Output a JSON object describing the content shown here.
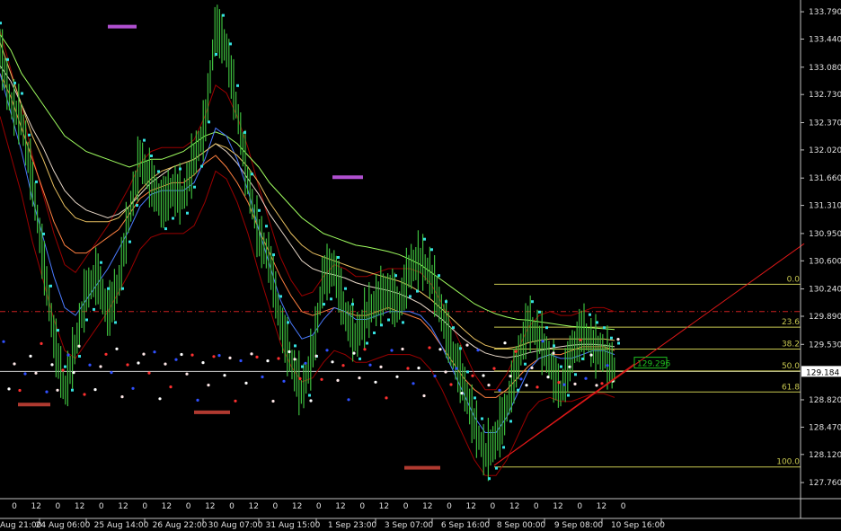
{
  "colors": {
    "background": "#000000",
    "axis": "#c0c0c0",
    "price_up": "#3dbb3d",
    "current_price_bg": "#ffffff",
    "current_price_fg": "#000000",
    "cyan_dots": "#35e0e0",
    "fib_line": "#c8c850",
    "red_dashdot": "#cc2020",
    "trendline": "#e01818",
    "envelope": "#9b0000",
    "ma_green": "#a0ff60",
    "ma_white": "#e8d8c8",
    "ma_orange": "#ff8040",
    "ma_blue": "#4a7bff",
    "ma_tan": "#e8c060",
    "purple_bar": "#b050d0",
    "brown_bar": "#b03a30",
    "box_label": "#20c020"
  },
  "chart_data": {
    "type": "line",
    "ylim": [
      127.6,
      133.86
    ],
    "y_ticks": [
      "133.790",
      "133.440",
      "133.080",
      "132.730",
      "132.370",
      "132.020",
      "131.660",
      "131.310",
      "130.950",
      "130.600",
      "130.240",
      "129.890",
      "129.530",
      "129.184",
      "128.820",
      "128.470",
      "128.120",
      "127.760"
    ],
    "y_tick_values": [
      133.79,
      133.44,
      133.08,
      132.73,
      132.37,
      132.02,
      131.66,
      131.31,
      130.95,
      130.6,
      130.24,
      129.89,
      129.53,
      129.184,
      128.82,
      128.47,
      128.12,
      127.76
    ],
    "current_price": "129.184",
    "current_price_value": 129.184,
    "box_label": "129.296",
    "box_label_value": 129.296,
    "date_labels": [
      "Aug 21:00",
      "24 Aug 06:00",
      "25 Aug 14:00",
      "26 Aug 22:00",
      "30 Aug 07:00",
      "31 Aug 15:00",
      "1 Sep 23:00",
      "3 Sep 07:00",
      "6 Sep 16:00",
      "8 Sep 00:00",
      "9 Sep 08:00",
      "10 Sep 16:00"
    ],
    "hour_labels": [
      "0",
      "12",
      "0",
      "12",
      "0",
      "12",
      "0",
      "12",
      "0",
      "12",
      "0",
      "12",
      "0",
      "12",
      "0",
      "12",
      "0",
      "12",
      "0",
      "12",
      "0",
      "12",
      "0",
      "12",
      "0",
      "12",
      "0",
      "12",
      "0"
    ],
    "fib_levels": [
      {
        "label": "0.0",
        "price": 130.3
      },
      {
        "label": "23.6",
        "price": 129.75
      },
      {
        "label": "38.2",
        "price": 129.47
      },
      {
        "label": "50.0",
        "price": 129.19
      },
      {
        "label": "61.8",
        "price": 128.92
      },
      {
        "label": "100.0",
        "price": 127.96
      }
    ],
    "red_dashdot_price": 129.95,
    "bar_indices": [
      0,
      6,
      12,
      18,
      24,
      30,
      36,
      42,
      48,
      54,
      60,
      66,
      72,
      78,
      84,
      90,
      96,
      102,
      108,
      114,
      120,
      126,
      132,
      138,
      144,
      150,
      156,
      162,
      168,
      174,
      180,
      186,
      192,
      198,
      204,
      210,
      216,
      222,
      228,
      234,
      240,
      246,
      252,
      258,
      264,
      270,
      276,
      282,
      288,
      294,
      300,
      306,
      312,
      318,
      324,
      330,
      336,
      342
    ],
    "series": [
      {
        "values": [
          133.3,
          132.6,
          132.4,
          131.6,
          130.6,
          129.6,
          128.9,
          129.5,
          130.2,
          130.4,
          129.9,
          130.3,
          131.2,
          131.9,
          131.6,
          131.3,
          131.5,
          131.4,
          131.9,
          132.3,
          133.6,
          133.3,
          132.5,
          131.6,
          130.9,
          130.6,
          129.8,
          129.3,
          128.9,
          129.4,
          130.4,
          130.5,
          129.9,
          129.6,
          129.9,
          130.1,
          130.2,
          130.0,
          130.5,
          130.6,
          130.4,
          129.9,
          129.4,
          129.0,
          128.5,
          128.1,
          128.3,
          128.7,
          129.3,
          129.8,
          129.6,
          129.3,
          128.9,
          129.4,
          129.7,
          129.5,
          129.4,
          129.2
        ],
        "color": "#3dbb3d"
      },
      {
        "values": [
          133.5,
          133.3,
          133.0,
          132.8,
          132.6,
          132.4,
          132.2,
          132.1,
          132.0,
          131.95,
          131.9,
          131.85,
          131.8,
          131.85,
          131.9,
          131.9,
          131.95,
          132.0,
          132.1,
          132.2,
          132.25,
          132.2,
          132.1,
          131.95,
          131.8,
          131.6,
          131.45,
          131.3,
          131.15,
          131.05,
          130.95,
          130.9,
          130.85,
          130.8,
          130.78,
          130.75,
          130.72,
          130.68,
          130.62,
          130.55,
          130.45,
          130.35,
          130.25,
          130.15,
          130.05,
          129.98,
          129.92,
          129.88,
          129.85,
          129.84,
          129.82,
          129.8,
          129.78,
          129.76,
          129.75,
          129.74,
          129.73,
          129.72
        ],
        "color": "#a0ff60"
      },
      {
        "values": [
          133.1,
          132.9,
          132.6,
          132.3,
          132.05,
          131.75,
          131.5,
          131.35,
          131.25,
          131.2,
          131.15,
          131.2,
          131.3,
          131.45,
          131.6,
          131.7,
          131.8,
          131.85,
          131.9,
          132.0,
          132.1,
          132.0,
          131.85,
          131.65,
          131.45,
          131.2,
          131.0,
          130.8,
          130.6,
          130.5,
          130.45,
          130.42,
          130.38,
          130.32,
          130.28,
          130.25,
          130.22,
          130.18,
          130.12,
          130.05,
          129.95,
          129.85,
          129.72,
          129.6,
          129.5,
          129.42,
          129.38,
          129.36,
          129.38,
          129.42,
          129.45,
          129.48,
          129.5,
          129.52,
          129.53,
          129.53,
          129.52,
          129.5
        ],
        "color": "#e8d8c8"
      },
      {
        "values": [
          133.0,
          132.7,
          132.3,
          131.9,
          131.5,
          131.1,
          130.8,
          130.7,
          130.7,
          130.8,
          130.9,
          131.0,
          131.2,
          131.4,
          131.5,
          131.55,
          131.6,
          131.6,
          131.7,
          131.85,
          131.95,
          131.8,
          131.6,
          131.35,
          131.0,
          130.7,
          130.4,
          130.15,
          129.95,
          129.9,
          129.95,
          130.0,
          129.95,
          129.9,
          129.9,
          129.95,
          130.0,
          129.95,
          129.9,
          129.85,
          129.7,
          129.5,
          129.3,
          129.1,
          128.95,
          128.85,
          128.85,
          128.95,
          129.1,
          129.25,
          129.35,
          129.4,
          129.4,
          129.45,
          129.5,
          129.5,
          129.5,
          129.45
        ],
        "color": "#ff8040"
      },
      {
        "values": [
          133.0,
          132.5,
          132.0,
          131.4,
          130.9,
          130.4,
          130.0,
          129.9,
          130.1,
          130.3,
          130.5,
          130.75,
          131.0,
          131.3,
          131.45,
          131.5,
          131.5,
          131.5,
          131.6,
          131.9,
          132.3,
          132.2,
          131.9,
          131.5,
          131.0,
          130.55,
          130.1,
          129.8,
          129.6,
          129.65,
          129.85,
          130.0,
          129.95,
          129.85,
          129.85,
          129.9,
          129.95,
          129.95,
          129.95,
          129.9,
          129.75,
          129.5,
          129.2,
          128.9,
          128.6,
          128.4,
          128.4,
          128.6,
          128.9,
          129.2,
          129.35,
          129.4,
          129.35,
          129.35,
          129.4,
          129.45,
          129.45,
          129.4
        ],
        "color": "#4a7bff"
      },
      {
        "values": [
          133.4,
          133.0,
          132.6,
          132.2,
          131.9,
          131.55,
          131.3,
          131.15,
          131.1,
          131.1,
          131.1,
          131.15,
          131.3,
          131.5,
          131.65,
          131.75,
          131.8,
          131.85,
          131.9,
          132.0,
          132.1,
          132.05,
          131.95,
          131.8,
          131.6,
          131.35,
          131.15,
          130.95,
          130.8,
          130.7,
          130.65,
          130.6,
          130.55,
          130.5,
          130.46,
          130.42,
          130.38,
          130.34,
          130.28,
          130.2,
          130.1,
          129.98,
          129.85,
          129.72,
          129.6,
          129.52,
          129.48,
          129.48,
          129.5,
          129.55,
          129.58,
          129.6,
          129.6,
          129.6,
          129.6,
          129.6,
          129.6,
          129.58
        ],
        "color": "#e8c060"
      }
    ],
    "markers": [
      {
        "label": "purple-high-1",
        "price": 133.6,
        "bar_start": 60,
        "bar_end": 76
      },
      {
        "label": "purple-high-2",
        "price": 131.67,
        "bar_start": 185,
        "bar_end": 202
      },
      {
        "label": "brown-low-1",
        "price": 128.76,
        "bar_start": 10,
        "bar_end": 28
      },
      {
        "label": "brown-low-2",
        "price": 128.66,
        "bar_start": 108,
        "bar_end": 128
      },
      {
        "label": "brown-low-3",
        "price": 127.95,
        "bar_start": 225,
        "bar_end": 245
      }
    ]
  }
}
